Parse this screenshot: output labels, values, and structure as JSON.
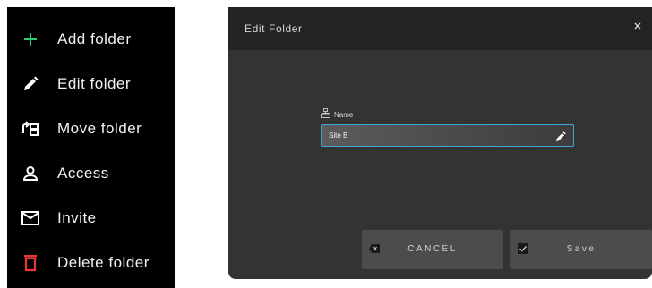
{
  "menu": {
    "items": [
      {
        "label": "Add folder",
        "icon": "plus-icon",
        "color": "#2ecc71"
      },
      {
        "label": "Edit folder",
        "icon": "pencil-icon",
        "color": "#ffffff"
      },
      {
        "label": "Move folder",
        "icon": "move-folder-icon",
        "color": "#ffffff"
      },
      {
        "label": "Access",
        "icon": "user-icon",
        "color": "#ffffff"
      },
      {
        "label": "Invite",
        "icon": "mail-icon",
        "color": "#ffffff"
      },
      {
        "label": "Delete folder",
        "icon": "trash-icon",
        "color": "#e53935"
      }
    ]
  },
  "dialog": {
    "title": "Edit Folder",
    "close_label": "×",
    "name_field": {
      "label": "Name",
      "value": "Site B"
    },
    "cancel_label": "CANCEL",
    "save_label": "Save",
    "accent_color": "#3fa6d9"
  }
}
